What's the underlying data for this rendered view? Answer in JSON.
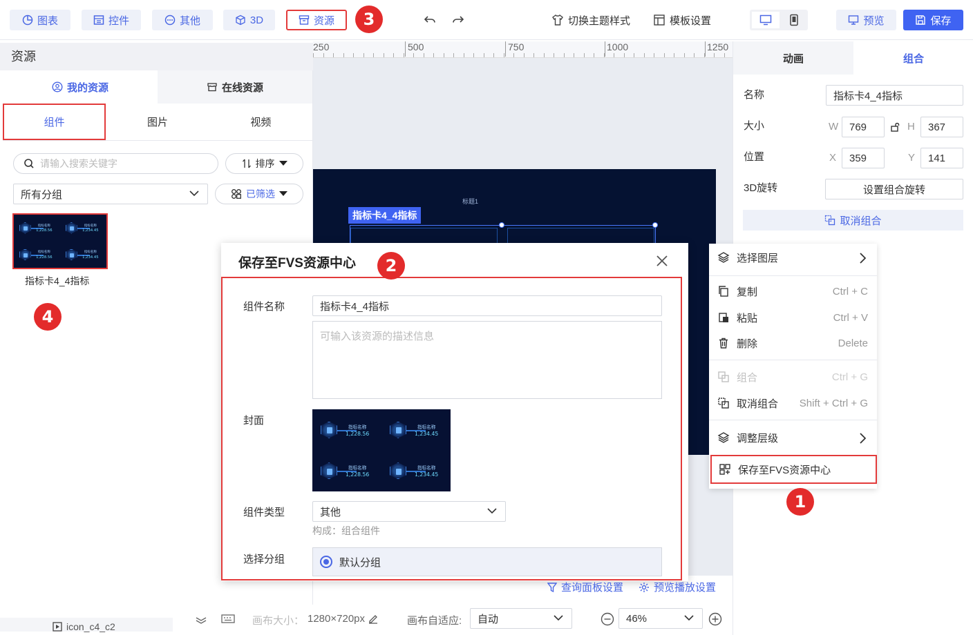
{
  "toolbar": {
    "chart_label": "图表",
    "widget_label": "控件",
    "other_label": "其他",
    "threed_label": "3D",
    "resource_label": "资源",
    "theme_label": "切换主题样式",
    "template_label": "模板设置",
    "preview_label": "预览",
    "save_label": "保存"
  },
  "badges": {
    "b1": "1",
    "b2": "2",
    "b3": "3",
    "b4": "4"
  },
  "left_panel": {
    "title": "资源",
    "source_tabs": [
      "我的资源",
      "在线资源"
    ],
    "type_tabs": [
      "组件",
      "图片",
      "视频"
    ],
    "search_placeholder": "请输入搜索关键字",
    "sort_label": "排序",
    "group_select": "所有分组",
    "filter_label": "已筛选",
    "asset_name": "指标卡4_4指标"
  },
  "kpi": {
    "label": "指标名称",
    "values": [
      "1,228.56",
      "1,234.45",
      "1,228.56",
      "1,234.45"
    ]
  },
  "ruler": {
    "labels": [
      "250",
      "500",
      "750",
      "1000",
      "1250"
    ]
  },
  "canvas": {
    "title": "标题1",
    "selected_label": "指标卡4_4指标"
  },
  "right_panel": {
    "tabs": [
      "动画",
      "组合"
    ],
    "name_label": "名称",
    "name_value": "指标卡4_4指标",
    "size_label": "大小",
    "w_label": "W",
    "w_value": "769",
    "h_label": "H",
    "h_value": "367",
    "pos_label": "位置",
    "x_label": "X",
    "x_value": "359",
    "y_label": "Y",
    "y_value": "141",
    "rot_label": "3D旋转",
    "rot_button": "设置组合旋转",
    "ungroup_button": "取消组合"
  },
  "context_menu": {
    "select_layer": "选择图层",
    "copy": "复制",
    "copy_sc": "Ctrl + C",
    "paste": "粘贴",
    "paste_sc": "Ctrl + V",
    "delete": "删除",
    "delete_sc": "Delete",
    "group": "组合",
    "group_sc": "Ctrl + G",
    "ungroup": "取消组合",
    "ungroup_sc": "Shift + Ctrl + G",
    "adjust_level": "调整层级",
    "save_fvs": "保存至FVS资源中心"
  },
  "dialog": {
    "title": "保存至FVS资源中心",
    "name_label": "组件名称",
    "name_value": "指标卡4_4指标",
    "desc_placeholder": "可输入该资源的描述信息",
    "cover_label": "封面",
    "type_label": "组件类型",
    "type_value": "其他",
    "compose_hint": "构成：组合组件",
    "group_label": "选择分组",
    "group_option": "默认分组"
  },
  "footer_links": {
    "query_panel": "查询面板设置",
    "preview_play": "预览播放设置"
  },
  "bottom_bar": {
    "canvas_size_label": "画布大小：",
    "canvas_size": "1280×720px",
    "fit_label": "画布自适应:",
    "fit_value": "自动",
    "zoom": "46%",
    "layer_item": "icon_c4_c2"
  }
}
